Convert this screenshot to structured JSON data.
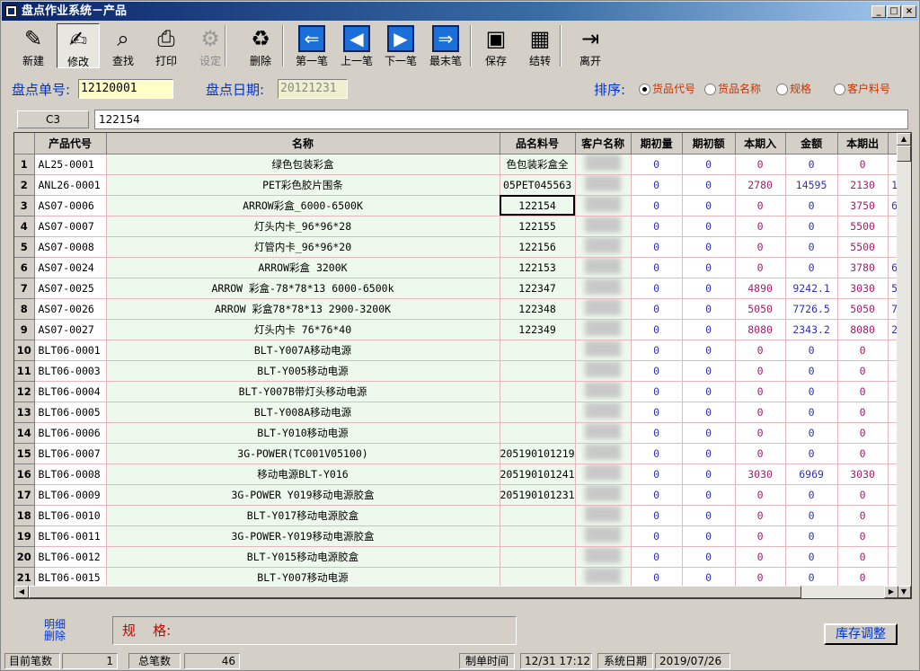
{
  "window": {
    "title": "盘点作业系统－产品",
    "min_label": "_",
    "max_label": "□",
    "close_label": "×"
  },
  "toolbar": [
    {
      "label": "新建",
      "icon": "new-icon",
      "glyph": "✎"
    },
    {
      "label": "修改",
      "icon": "edit-icon",
      "glyph": "✍",
      "selected": true
    },
    {
      "label": "查找",
      "icon": "binoculars-icon",
      "glyph": "⌕"
    },
    {
      "label": "打印",
      "icon": "print-icon",
      "glyph": "⎙"
    },
    {
      "label": "设定",
      "icon": "settings-icon",
      "glyph": "⚙",
      "disabled": true
    },
    {
      "label": "删除",
      "icon": "dump-icon",
      "glyph": "♻"
    },
    {
      "label": "第一笔",
      "icon": "first-record-icon",
      "glyph": "⇐"
    },
    {
      "label": "上一笔",
      "icon": "previous-record-icon",
      "glyph": "◀"
    },
    {
      "label": "下一笔",
      "icon": "next-record-icon",
      "glyph": "▶"
    },
    {
      "label": "最末笔",
      "icon": "last-record-icon",
      "glyph": "⇒"
    },
    {
      "label": "保存",
      "icon": "save-icon",
      "glyph": "▣"
    },
    {
      "label": "结转",
      "icon": "calculator-icon",
      "glyph": "▦"
    },
    {
      "label": "离开",
      "icon": "exit-door-icon",
      "glyph": "⇥"
    }
  ],
  "form": {
    "order_no_label": "盘点单号:",
    "order_no": "12120001",
    "date_label": "盘点日期:",
    "date": "20121231",
    "sort_label": "排序:",
    "sort_options": [
      "货品代号",
      "货品名称",
      "规格",
      "客户料号"
    ]
  },
  "cell": {
    "ref": "C3",
    "value": "122154"
  },
  "grid": {
    "headers": [
      "产品代号",
      "名称",
      "品名料号",
      "客户名称",
      "期初量",
      "期初额",
      "本期入",
      "金额",
      "本期出",
      ""
    ],
    "rows": [
      [
        "1",
        "AL25-0001",
        "绿色包装彩盒",
        "色包装彩盒全",
        "",
        "0",
        "0",
        "0",
        "0",
        "0",
        ""
      ],
      [
        "2",
        "ANL26-0001",
        "PET彩色胶片围条",
        "05PET045563",
        "",
        "0",
        "0",
        "2780",
        "14595",
        "2130",
        "1"
      ],
      [
        "3",
        "AS07-0006",
        "ARROW彩盒_6000-6500K",
        "122154",
        "",
        "0",
        "0",
        "0",
        "0",
        "3750",
        "6"
      ],
      [
        "4",
        "AS07-0007",
        "灯头内卡_96*96*28",
        "122155",
        "",
        "0",
        "0",
        "0",
        "0",
        "5500",
        ""
      ],
      [
        "5",
        "AS07-0008",
        "灯管内卡_96*96*20",
        "122156",
        "",
        "0",
        "0",
        "0",
        "0",
        "5500",
        ""
      ],
      [
        "6",
        "AS07-0024",
        "ARROW彩盒 3200K",
        "122153",
        "",
        "0",
        "0",
        "0",
        "0",
        "3780",
        "6"
      ],
      [
        "7",
        "AS07-0025",
        "ARROW 彩盒-78*78*13  6000-6500k",
        "122347",
        "",
        "0",
        "0",
        "4890",
        "9242.1",
        "3030",
        "5"
      ],
      [
        "8",
        "AS07-0026",
        "ARROW 彩盒78*78*13  2900-3200K",
        "122348",
        "",
        "0",
        "0",
        "5050",
        "7726.5",
        "5050",
        "7"
      ],
      [
        "9",
        "AS07-0027",
        "灯头内卡  76*76*40",
        "122349",
        "",
        "0",
        "0",
        "8080",
        "2343.2",
        "8080",
        "2"
      ],
      [
        "10",
        "BLT06-0001",
        "BLT-Y007A移动电源",
        "",
        "",
        "0",
        "0",
        "0",
        "0",
        "0",
        ""
      ],
      [
        "11",
        "BLT06-0003",
        "BLT-Y005移动电源",
        "",
        "",
        "0",
        "0",
        "0",
        "0",
        "0",
        ""
      ],
      [
        "12",
        "BLT06-0004",
        "BLT-Y007B带灯头移动电源",
        "",
        "",
        "0",
        "0",
        "0",
        "0",
        "0",
        ""
      ],
      [
        "13",
        "BLT06-0005",
        "BLT-Y008A移动电源",
        "",
        "",
        "0",
        "0",
        "0",
        "0",
        "0",
        ""
      ],
      [
        "14",
        "BLT06-0006",
        "BLT-Y010移动电源",
        "",
        "",
        "0",
        "0",
        "0",
        "0",
        "0",
        ""
      ],
      [
        "15",
        "BLT06-0007",
        "3G-POWER(TC001V05100)",
        "205190101219",
        "",
        "0",
        "0",
        "0",
        "0",
        "0",
        ""
      ],
      [
        "16",
        "BLT06-0008",
        "移动电源BLT-Y016",
        "205190101241",
        "",
        "0",
        "0",
        "3030",
        "6969",
        "3030",
        ""
      ],
      [
        "17",
        "BLT06-0009",
        "3G-POWER Y019移动电源胶盒",
        "205190101231",
        "",
        "0",
        "0",
        "0",
        "0",
        "0",
        ""
      ],
      [
        "18",
        "BLT06-0010",
        "BLT-Y017移动电源胶盒",
        "",
        "",
        "0",
        "0",
        "0",
        "0",
        "0",
        ""
      ],
      [
        "19",
        "BLT06-0011",
        "3G-POWER-Y019移动电源胶盒",
        "",
        "",
        "0",
        "0",
        "0",
        "0",
        "0",
        ""
      ],
      [
        "20",
        "BLT06-0012",
        "BLT-Y015移动电源胶盒",
        "",
        "",
        "0",
        "0",
        "0",
        "0",
        "0",
        ""
      ],
      [
        "21",
        "BLT06-0015",
        "BLT-Y007移动电源",
        "",
        "",
        "0",
        "0",
        "0",
        "0",
        "0",
        ""
      ]
    ]
  },
  "bottom": {
    "detail_line1": "明细",
    "detail_line2": "删除",
    "spec_label": "规    格:",
    "adjust_button": "库存调整"
  },
  "status": {
    "current_label": "目前笔数",
    "current_value": "1",
    "total_label": "总笔数",
    "total_value": "46",
    "made_time_label": "制单时间",
    "made_time_value": "12/31 17:12",
    "system_date_label": "系统日期",
    "system_date_value": "2019/07/26"
  }
}
